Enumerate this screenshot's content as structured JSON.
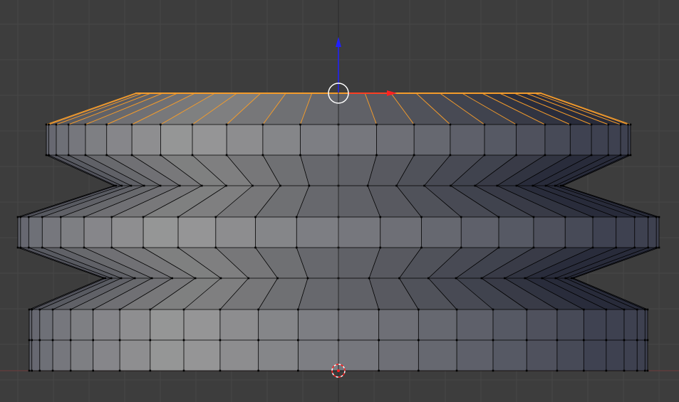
{
  "viewport": {
    "mode": "edit-mode-front-orthographic",
    "background": "#3d3d3d",
    "grid_color": "#464646",
    "face_shade_light": "#999999",
    "face_shade_dark": "#3e4150",
    "edge_color": "#000000",
    "vertex_color": "#000000",
    "selected_color": "#f39b2b"
  },
  "gizmo": {
    "z_axis_color": "#2020ff",
    "x_axis_color": "#ff2020",
    "handle_color": "#ffffff"
  },
  "cursor_3d": {
    "ring_primary": "#ffffff",
    "ring_secondary": "#ff2020"
  },
  "icons": {
    "gizmo_up": "translate-z-arrow-icon",
    "gizmo_right": "translate-x-arrow-icon",
    "gizmo_center": "transform-center-icon",
    "cursor": "3d-cursor-icon"
  }
}
